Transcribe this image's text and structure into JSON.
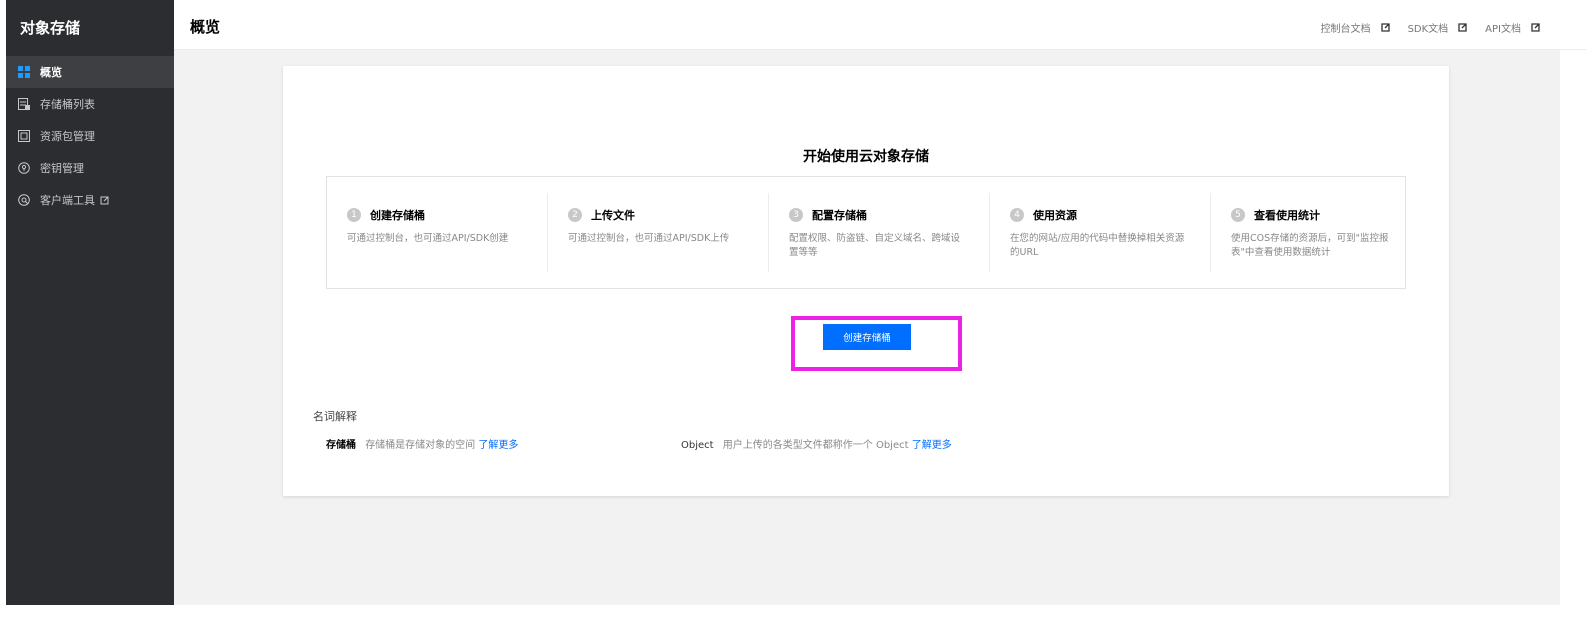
{
  "sidebar": {
    "title": "对象存储",
    "items": [
      {
        "label": "概览",
        "icon": "grid-icon",
        "active": true
      },
      {
        "label": "存储桶列表",
        "icon": "bucket-list-icon",
        "active": false
      },
      {
        "label": "资源包管理",
        "icon": "package-icon",
        "active": false
      },
      {
        "label": "密钥管理",
        "icon": "key-icon",
        "active": false
      },
      {
        "label": "客户端工具",
        "icon": "client-tool-icon",
        "active": false,
        "external": true
      }
    ]
  },
  "header": {
    "title": "概览",
    "links": [
      {
        "label": "控制台文档"
      },
      {
        "label": "SDK文档"
      },
      {
        "label": "API文档"
      }
    ]
  },
  "card": {
    "title": "开始使用云对象存储",
    "steps": [
      {
        "num": "1",
        "title": "创建存储桶",
        "desc": "可通过控制台，也可通过API/SDK创建"
      },
      {
        "num": "2",
        "title": "上传文件",
        "desc": "可通过控制台，也可通过API/SDK上传"
      },
      {
        "num": "3",
        "title": "配置存储桶",
        "desc": "配置权限、防盗链、自定义域名、跨域设置等等"
      },
      {
        "num": "4",
        "title": "使用资源",
        "desc": "在您的网站/应用的代码中替换掉相关资源的URL"
      },
      {
        "num": "5",
        "title": "查看使用统计",
        "desc": "使用COS存储的资源后，可到\"监控报表\"中查看使用数据统计"
      }
    ],
    "create_button": "创建存储桶",
    "glossary": {
      "title": "名词解释",
      "items": [
        {
          "term": "存储桶",
          "desc": "存储桶是存储对象的空间",
          "more": "了解更多"
        },
        {
          "term": "Object",
          "desc": "用户上传的各类型文件都称作一个 Object",
          "more": "了解更多"
        }
      ]
    }
  },
  "colors": {
    "sidebar_bg": "#2b2d30",
    "accent": "#006eff",
    "highlight": "#ee22e6"
  }
}
